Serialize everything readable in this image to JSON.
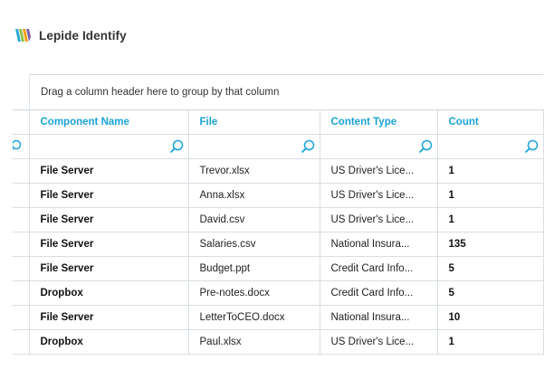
{
  "app": {
    "title": "Lepide Identify",
    "logo_icon": "lepide-stripes-logo-icon"
  },
  "grid": {
    "group_hint": "Drag a column header here to group by that column",
    "columns": [
      {
        "label": "Component Name"
      },
      {
        "label": "File"
      },
      {
        "label": "Content Type"
      },
      {
        "label": "Count"
      }
    ],
    "rows": [
      {
        "component": "File Server",
        "file": "Trevor.xlsx",
        "content_type": "US Driver's Lice...",
        "count": "1"
      },
      {
        "component": "File Server",
        "file": "Anna.xlsx",
        "content_type": "US Driver's Lice...",
        "count": "1"
      },
      {
        "component": "File Server",
        "file": "David.csv",
        "content_type": "US Driver's Lice...",
        "count": "1"
      },
      {
        "component": "File Server",
        "file": "Salaries.csv",
        "content_type": "National Insura...",
        "count": "135"
      },
      {
        "component": "File Server",
        "file": "Budget.ppt",
        "content_type": "Credit Card Info...",
        "count": "5"
      },
      {
        "component": "Dropbox",
        "file": "Pre-notes.docx",
        "content_type": "Credit Card Info...",
        "count": "5"
      },
      {
        "component": "File Server",
        "file": "LetterToCEO.docx",
        "content_type": "National Insura...",
        "count": "10"
      },
      {
        "component": "Dropbox",
        "file": "Paul.xlsx",
        "content_type": "US Driver's Lice...",
        "count": "1"
      }
    ],
    "accent_color": "#1aa3d6",
    "filter_icon": "magnifier-icon"
  }
}
